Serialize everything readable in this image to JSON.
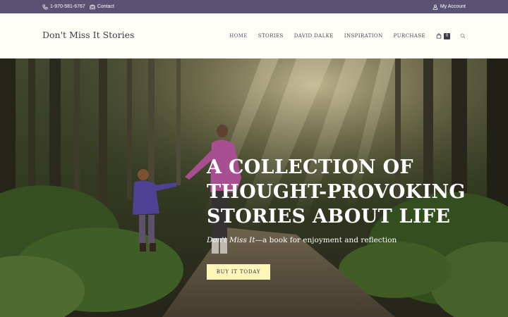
{
  "topbar": {
    "phone": "1-970-581-6767",
    "contact": "Contact",
    "account": "My Account",
    "bg_color": "#5a5273"
  },
  "header": {
    "logo": "Don't Miss It Stories",
    "nav": [
      "HOME",
      "STORIES",
      "DAVID DALKE",
      "INSPIRATION",
      "PURCHASE"
    ],
    "active_nav": "HOME",
    "cart_count": "0"
  },
  "hero": {
    "headline": [
      "A COLLECTION OF",
      "THOUGHT-PROVOKING",
      "STORIES ABOUT LIFE"
    ],
    "tagline_italic": "Don't Miss It",
    "tagline_rest": "—a book for enjoyment and reflection",
    "cta_label": "BUY IT TODAY",
    "cta_color": "#fdf6b8"
  },
  "icons": {
    "phone": "phone-icon",
    "contact": "envelope-icon",
    "account": "user-icon",
    "cart": "bag-icon",
    "search": "search-icon"
  }
}
